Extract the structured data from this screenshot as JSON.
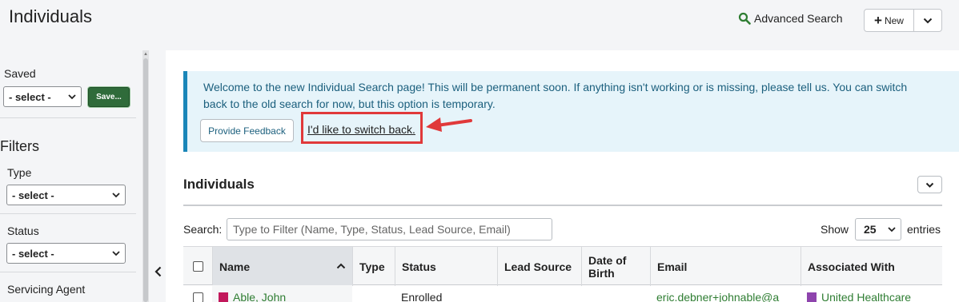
{
  "header": {
    "title": "Individuals",
    "advanced_search_label": "Advanced Search",
    "new_label": "New"
  },
  "sidebar": {
    "saved_label": "Saved",
    "saved_select_value": "- select -",
    "save_button_label": "Save...",
    "filters_title": "Filters",
    "type_label": "Type",
    "type_select_value": "- select -",
    "status_label": "Status",
    "status_select_value": "- select -",
    "servicing_agent_label": "Servicing Agent"
  },
  "banner": {
    "message": "Welcome to the new Individual Search page! This will be permanent soon. If anything isn't working or is missing, please tell us. You can switch back to the old search for now, but this option is temporary.",
    "feedback_button_label": "Provide Feedback",
    "switch_back_label": "I'd like to switch back."
  },
  "section": {
    "title": "Individuals"
  },
  "table_controls": {
    "search_label": "Search:",
    "search_placeholder": "Type to Filter (Name, Type, Status, Lead Source, Email)",
    "search_value": "",
    "show_label": "Show",
    "page_size": "25",
    "entries_label": "entries"
  },
  "table": {
    "columns": [
      "Name",
      "Type",
      "Status",
      "Lead Source",
      "Date of Birth",
      "Email",
      "Associated With"
    ],
    "rows": [
      {
        "name": "Able, John",
        "type": "",
        "status": "Enrolled",
        "lead_source": "",
        "dob": "",
        "email": "eric.debner+johnable@a",
        "associated_with": "United Healthcare"
      }
    ]
  },
  "colors": {
    "accent_green": "#2f6b3a",
    "banner_border": "#1a86b8",
    "highlight_red": "#e0393a"
  }
}
